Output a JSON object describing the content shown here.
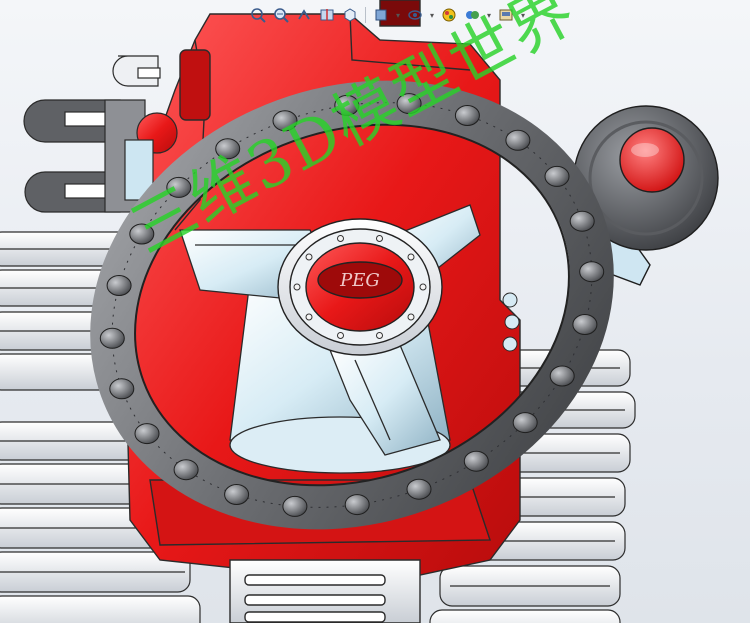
{
  "toolbar": {
    "tools": [
      {
        "name": "zoom-to-fit-icon"
      },
      {
        "name": "zoom-to-area-icon"
      },
      {
        "name": "previous-view-icon"
      },
      {
        "name": "section-view-icon"
      },
      {
        "name": "view-orientation-icon"
      },
      {
        "name": "display-style-icon"
      },
      {
        "name": "hide-show-items-icon"
      },
      {
        "name": "edit-appearance-icon"
      },
      {
        "name": "apply-scene-icon"
      },
      {
        "name": "view-settings-icon"
      }
    ]
  },
  "watermark": {
    "text": "三维3D模型世界",
    "color": "#28d228"
  },
  "model": {
    "body_color": "#ec1c1c",
    "steering_wheel_color": "#6d6f73",
    "hub_logo_text": "PEG"
  }
}
